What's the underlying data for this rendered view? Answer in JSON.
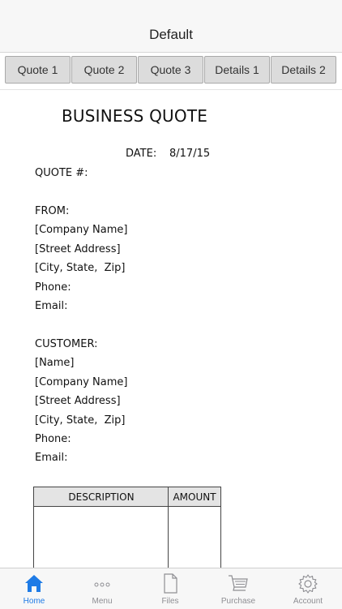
{
  "navbar": {
    "title": "Default"
  },
  "segments": [
    "Quote 1",
    "Quote 2",
    "Quote 3",
    "Details 1",
    "Details 2"
  ],
  "document": {
    "heading": "BUSINESS QUOTE",
    "date_label": "DATE:",
    "date_value": "8/17/15",
    "quote_number_label": "QUOTE #:",
    "from": {
      "label": "FROM:",
      "company": "[Company Name]",
      "street": "[Street Address]",
      "city": "[City, State,  Zip]",
      "phone": "Phone:",
      "email": "Email:"
    },
    "customer": {
      "label": "CUSTOMER:",
      "name": "[Name]",
      "company": "[Company Name]",
      "street": "[Street Address]",
      "city": "[City, State,  Zip]",
      "phone": "Phone:",
      "email": "Email:"
    },
    "table": {
      "headers": [
        "DESCRIPTION",
        "AMOUNT"
      ]
    }
  },
  "tabbar": {
    "active": "Home",
    "active_color": "#1e7be6",
    "items": [
      {
        "label": "Home",
        "icon": "home-icon"
      },
      {
        "label": "Menu",
        "icon": "more-dots-icon"
      },
      {
        "label": "Files",
        "icon": "file-icon"
      },
      {
        "label": "Purchase",
        "icon": "cart-icon"
      },
      {
        "label": "Account",
        "icon": "gear-icon"
      }
    ]
  }
}
